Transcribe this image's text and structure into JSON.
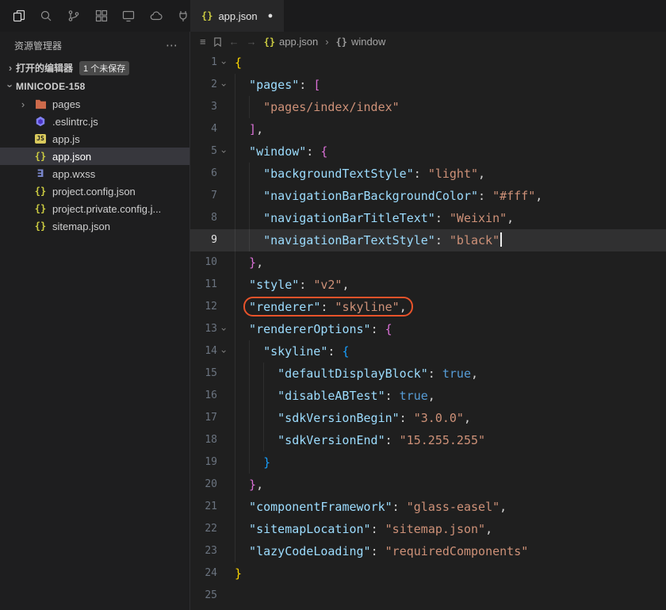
{
  "colors": {
    "key": "#9cdcfe",
    "str": "#ce9178",
    "pun": "#d4d4d4",
    "b1": "#ffd700",
    "b2": "#da70d6",
    "b3": "#179fff",
    "bool": "#569cd6",
    "annotation": "#e8532a"
  },
  "activity_bar": {
    "icons": [
      "files",
      "search",
      "source-control",
      "extensions",
      "preview",
      "cloud",
      "plugin"
    ]
  },
  "tab": {
    "title": "app.json",
    "modified_dot": "●",
    "icon": "{}"
  },
  "sidebar": {
    "title": "资源管理器",
    "more_label": "⋯",
    "open_editors_label": "打开的编辑器",
    "unsaved_badge": "1 个未保存",
    "project": "MINICODE-158",
    "files": [
      {
        "name": "pages",
        "icon": "folder",
        "chevron": true
      },
      {
        "name": ".eslintrc.js",
        "icon": "eslint"
      },
      {
        "name": "app.js",
        "icon": "js"
      },
      {
        "name": "app.json",
        "icon": "json",
        "selected": true
      },
      {
        "name": "app.wxss",
        "icon": "wxss"
      },
      {
        "name": "project.config.json",
        "icon": "json"
      },
      {
        "name": "project.private.config.j...",
        "icon": "json"
      },
      {
        "name": "sitemap.json",
        "icon": "json"
      }
    ]
  },
  "breadcrumb": {
    "file": "app.json",
    "separator": "›",
    "symbol": "window"
  },
  "editor": {
    "lines": [
      {
        "n": 1,
        "indent": 0,
        "fold": true,
        "tokens": [
          [
            "{",
            "b1"
          ]
        ]
      },
      {
        "n": 2,
        "indent": 1,
        "fold": true,
        "tokens": [
          [
            "\"pages\"",
            "key"
          ],
          [
            ": ",
            "pun"
          ],
          [
            "[",
            "b2"
          ]
        ]
      },
      {
        "n": 3,
        "indent": 2,
        "tokens": [
          [
            "\"pages/index/index\"",
            "str"
          ]
        ]
      },
      {
        "n": 4,
        "indent": 1,
        "tokens": [
          [
            "]",
            "b2"
          ],
          [
            ",",
            "pun"
          ]
        ]
      },
      {
        "n": 5,
        "indent": 1,
        "fold": true,
        "tokens": [
          [
            "\"window\"",
            "key"
          ],
          [
            ": ",
            "pun"
          ],
          [
            "{",
            "b2"
          ]
        ]
      },
      {
        "n": 6,
        "indent": 2,
        "tokens": [
          [
            "\"backgroundTextStyle\"",
            "key"
          ],
          [
            ": ",
            "pun"
          ],
          [
            "\"light\"",
            "str"
          ],
          [
            ",",
            "pun"
          ]
        ]
      },
      {
        "n": 7,
        "indent": 2,
        "tokens": [
          [
            "\"navigationBarBackgroundColor\"",
            "key"
          ],
          [
            ": ",
            "pun"
          ],
          [
            "\"#fff\"",
            "str"
          ],
          [
            ",",
            "pun"
          ]
        ]
      },
      {
        "n": 8,
        "indent": 2,
        "tokens": [
          [
            "\"navigationBarTitleText\"",
            "key"
          ],
          [
            ": ",
            "pun"
          ],
          [
            "\"Weixin\"",
            "str"
          ],
          [
            ",",
            "pun"
          ]
        ]
      },
      {
        "n": 9,
        "indent": 2,
        "current": true,
        "cursor": true,
        "tokens": [
          [
            "\"navigationBarTextStyle\"",
            "key"
          ],
          [
            ": ",
            "pun"
          ],
          [
            "\"black\"",
            "str"
          ]
        ]
      },
      {
        "n": 10,
        "indent": 1,
        "tokens": [
          [
            "}",
            "b2"
          ],
          [
            ",",
            "pun"
          ]
        ]
      },
      {
        "n": 11,
        "indent": 1,
        "tokens": [
          [
            "\"style\"",
            "key"
          ],
          [
            ": ",
            "pun"
          ],
          [
            "\"v2\"",
            "str"
          ],
          [
            ",",
            "pun"
          ]
        ]
      },
      {
        "n": 12,
        "indent": 1,
        "annotate": true,
        "tokens": [
          [
            "\"renderer\"",
            "key"
          ],
          [
            ": ",
            "pun"
          ],
          [
            "\"skyline\"",
            "str"
          ],
          [
            ",",
            "pun"
          ]
        ]
      },
      {
        "n": 13,
        "indent": 1,
        "fold": true,
        "tokens": [
          [
            "\"rendererOptions\"",
            "key"
          ],
          [
            ": ",
            "pun"
          ],
          [
            "{",
            "b2"
          ]
        ]
      },
      {
        "n": 14,
        "indent": 2,
        "fold": true,
        "tokens": [
          [
            "\"skyline\"",
            "key"
          ],
          [
            ": ",
            "pun"
          ],
          [
            "{",
            "b3"
          ]
        ]
      },
      {
        "n": 15,
        "indent": 3,
        "tokens": [
          [
            "\"defaultDisplayBlock\"",
            "key"
          ],
          [
            ": ",
            "pun"
          ],
          [
            "true",
            "bool"
          ],
          [
            ",",
            "pun"
          ]
        ]
      },
      {
        "n": 16,
        "indent": 3,
        "tokens": [
          [
            "\"disableABTest\"",
            "key"
          ],
          [
            ": ",
            "pun"
          ],
          [
            "true",
            "bool"
          ],
          [
            ",",
            "pun"
          ]
        ]
      },
      {
        "n": 17,
        "indent": 3,
        "tokens": [
          [
            "\"sdkVersionBegin\"",
            "key"
          ],
          [
            ": ",
            "pun"
          ],
          [
            "\"3.0.0\"",
            "str"
          ],
          [
            ",",
            "pun"
          ]
        ]
      },
      {
        "n": 18,
        "indent": 3,
        "tokens": [
          [
            "\"sdkVersionEnd\"",
            "key"
          ],
          [
            ": ",
            "pun"
          ],
          [
            "\"15.255.255\"",
            "str"
          ]
        ]
      },
      {
        "n": 19,
        "indent": 2,
        "tokens": [
          [
            "}",
            "b3"
          ]
        ]
      },
      {
        "n": 20,
        "indent": 1,
        "tokens": [
          [
            "}",
            "b2"
          ],
          [
            ",",
            "pun"
          ]
        ]
      },
      {
        "n": 21,
        "indent": 1,
        "tokens": [
          [
            "\"componentFramework\"",
            "key"
          ],
          [
            ": ",
            "pun"
          ],
          [
            "\"glass-easel\"",
            "str"
          ],
          [
            ",",
            "pun"
          ]
        ]
      },
      {
        "n": 22,
        "indent": 1,
        "tokens": [
          [
            "\"sitemapLocation\"",
            "key"
          ],
          [
            ": ",
            "pun"
          ],
          [
            "\"sitemap.json\"",
            "str"
          ],
          [
            ",",
            "pun"
          ]
        ]
      },
      {
        "n": 23,
        "indent": 1,
        "tokens": [
          [
            "\"lazyCodeLoading\"",
            "key"
          ],
          [
            ": ",
            "pun"
          ],
          [
            "\"requiredComponents\"",
            "str"
          ]
        ]
      },
      {
        "n": 24,
        "indent": 0,
        "tokens": [
          [
            "}",
            "b1"
          ]
        ]
      },
      {
        "n": 25,
        "indent": 0,
        "tokens": []
      }
    ]
  }
}
